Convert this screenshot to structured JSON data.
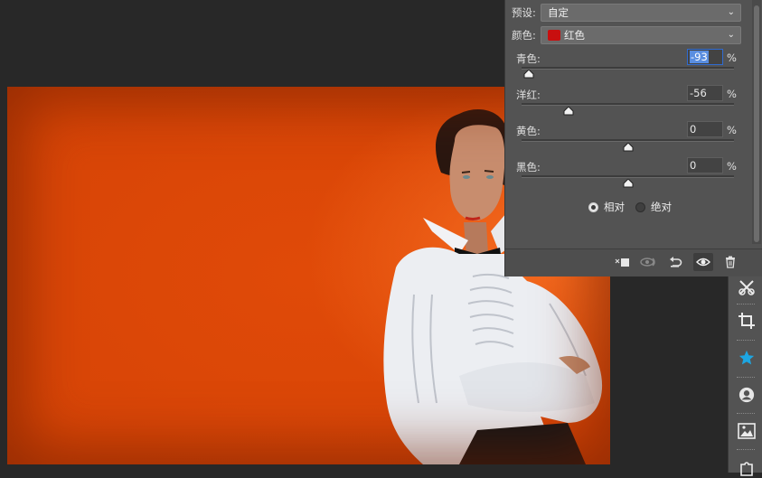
{
  "preset": {
    "label": "预设:",
    "value": "自定"
  },
  "colors": {
    "label": "颜色:",
    "value": "红色",
    "swatch": "#c80f0f"
  },
  "sliders": [
    {
      "label": "青色:",
      "value": "-93",
      "unit": "%",
      "level": -93
    },
    {
      "label": "洋红:",
      "value": "-56",
      "unit": "%",
      "level": -56
    },
    {
      "label": "黄色:",
      "value": "0",
      "unit": "%",
      "level": 0
    },
    {
      "label": "黑色:",
      "value": "0",
      "unit": "%",
      "level": 0
    }
  ],
  "method": {
    "relative": "相对",
    "absolute": "绝对",
    "selected": "relative"
  },
  "panel_footer_icons": [
    "clip-to-layer-icon",
    "view-previous-icon",
    "reset-icon",
    "visibility-icon",
    "delete-icon"
  ],
  "toolbar_icons": [
    "brush-settings-icon",
    "crop-icon",
    "star-icon",
    "person-icon",
    "image-icon",
    "puzzle-icon"
  ],
  "accent": "#2f6bd1"
}
